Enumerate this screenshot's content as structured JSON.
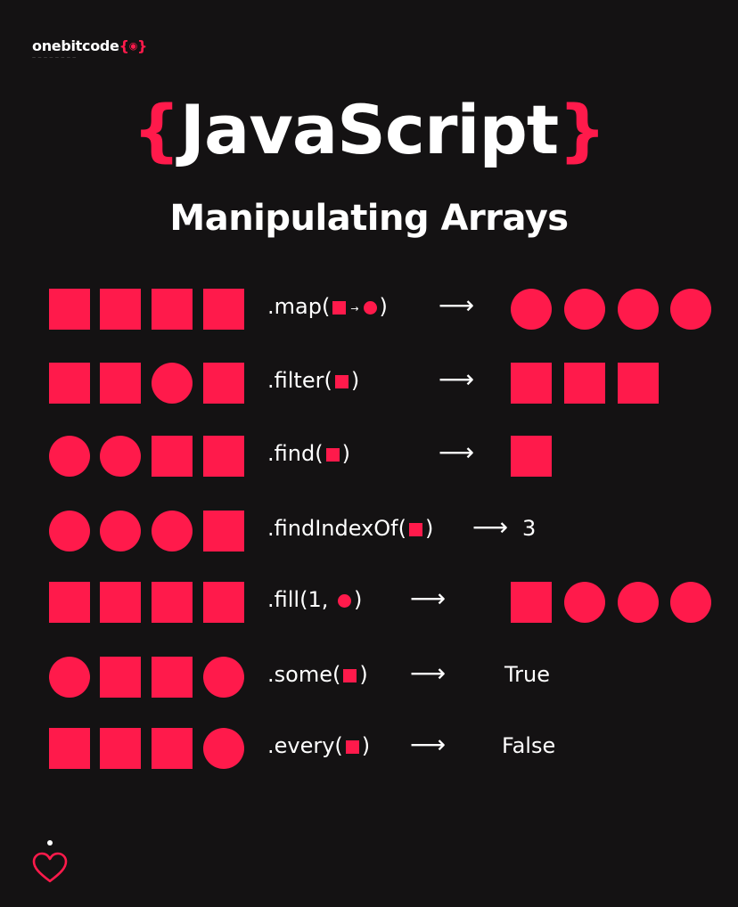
{
  "brand": {
    "name_white": "onebitcode",
    "name_red": "{",
    "name_red_end": "}",
    "tagline": "— — — — — — — —"
  },
  "title": {
    "open_brace": "{",
    "word": "JavaScript",
    "close_brace": "}"
  },
  "subtitle": "Manipulating Arrays",
  "colors": {
    "accent": "#ff1a4b",
    "background": "#141213",
    "text": "#ffffff"
  },
  "rows": [
    {
      "input": [
        "square",
        "square",
        "square",
        "square"
      ],
      "method_name": ".map(",
      "arg": "square-to-circle",
      "method_close": ")",
      "arrow": "⟶",
      "output": [
        "circle",
        "circle",
        "circle",
        "circle"
      ]
    },
    {
      "input": [
        "square",
        "square",
        "circle",
        "square"
      ],
      "method_name": ".filter(",
      "arg": "square",
      "method_close": ")",
      "arrow": "⟶",
      "output": [
        "square",
        "square",
        "square"
      ]
    },
    {
      "input": [
        "circle",
        "circle",
        "square",
        "square"
      ],
      "method_name": ".find(",
      "arg": "square",
      "method_close": ")",
      "arrow": "⟶",
      "output": [
        "square"
      ]
    },
    {
      "input": [
        "circle",
        "circle",
        "circle",
        "square"
      ],
      "method_name": ".findIndexOf(",
      "arg": "square",
      "method_close": ")",
      "arrow": "⟶",
      "output_text": "3"
    },
    {
      "input": [
        "square",
        "square",
        "square",
        "square"
      ],
      "method_name": ".fill(1, ",
      "arg": "circle",
      "method_close": ")",
      "arrow": "⟶",
      "output": [
        "square",
        "circle",
        "circle",
        "circle"
      ]
    },
    {
      "input": [
        "circle",
        "square",
        "square",
        "circle"
      ],
      "method_name": ".some(",
      "arg": "square",
      "method_close": ")",
      "arrow": "⟶",
      "output_text": "True"
    },
    {
      "input": [
        "square",
        "square",
        "square",
        "circle"
      ],
      "method_name": ".every(",
      "arg": "square",
      "method_close": ")",
      "arrow": "⟶",
      "output_text": "False"
    }
  ],
  "footer": {
    "icon": "heart-icon"
  }
}
